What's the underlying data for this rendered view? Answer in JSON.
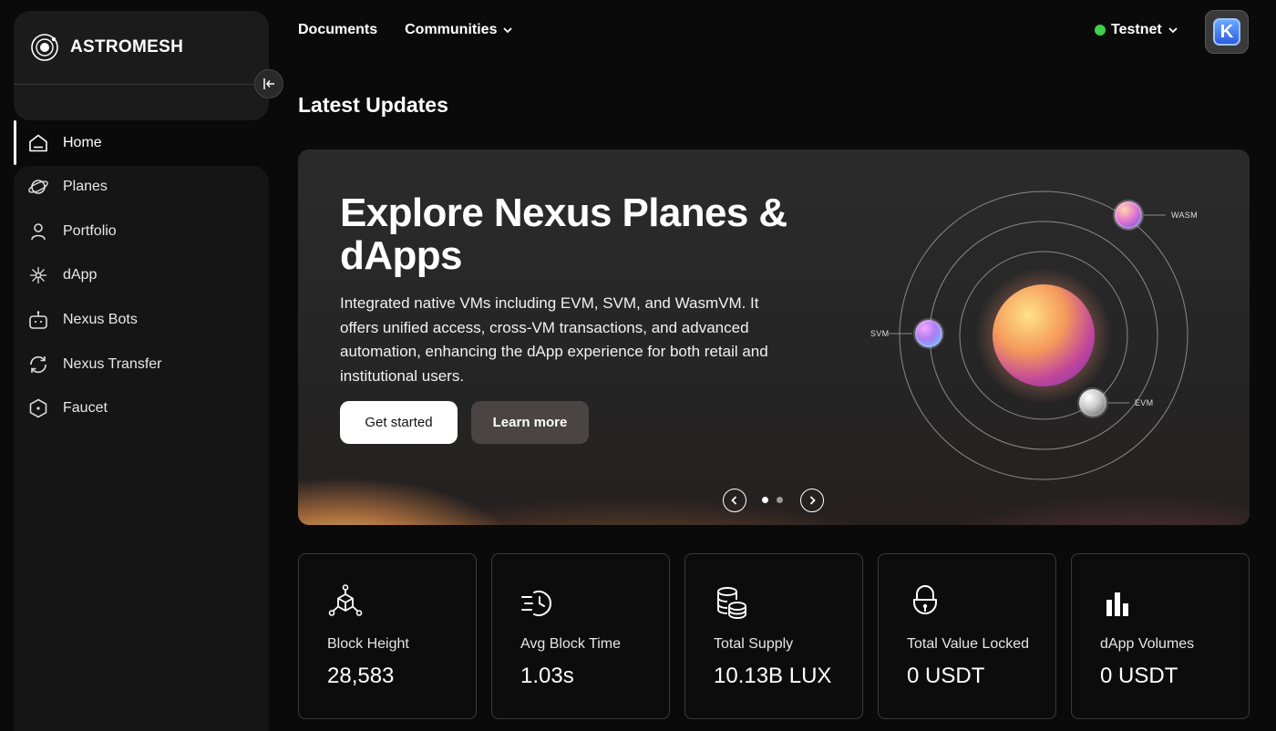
{
  "brand": {
    "name": "ASTROMESH",
    "logo_icon": "astromesh-logo-icon"
  },
  "sidebar": {
    "items": [
      {
        "label": "Home",
        "icon": "home-icon",
        "active": true
      },
      {
        "label": "Planes",
        "icon": "planet-icon"
      },
      {
        "label": "Portfolio",
        "icon": "user-icon"
      },
      {
        "label": "dApp",
        "icon": "network-icon"
      },
      {
        "label": "Nexus Bots",
        "icon": "bot-icon"
      },
      {
        "label": "Nexus Transfer",
        "icon": "refresh-icon"
      },
      {
        "label": "Faucet",
        "icon": "hexagon-icon"
      }
    ]
  },
  "topnav": {
    "documents": "Documents",
    "communities": "Communities",
    "network": "Testnet",
    "network_status_color": "#3fd04a",
    "avatar_letter": "K"
  },
  "section_title": "Latest Updates",
  "banner": {
    "title": "Explore Nexus Planes & dApps",
    "description": "Integrated native VMs including EVM, SVM, and WasmVM. It offers unified access, cross-VM transactions, and advanced automation, enhancing the dApp experience for both retail and institutional users.",
    "primary_button": "Get started",
    "secondary_button": "Learn more",
    "planets": {
      "wasm": "WASM",
      "svm": "SVM",
      "evm": "EVM"
    },
    "carousel": {
      "current": 1,
      "total": 2
    }
  },
  "stats": [
    {
      "label": "Block Height",
      "value": "28,583",
      "icon": "blocks-icon"
    },
    {
      "label": "Avg Block Time",
      "value": "1.03s",
      "icon": "clock-history-icon"
    },
    {
      "label": "Total Supply",
      "value": "10.13B LUX",
      "icon": "coins-icon"
    },
    {
      "label": "Total Value Locked",
      "value": "0 USDT",
      "icon": "lock-icon"
    },
    {
      "label": "dApp Volumes",
      "value": "0 USDT",
      "icon": "bar-chart-icon"
    }
  ]
}
